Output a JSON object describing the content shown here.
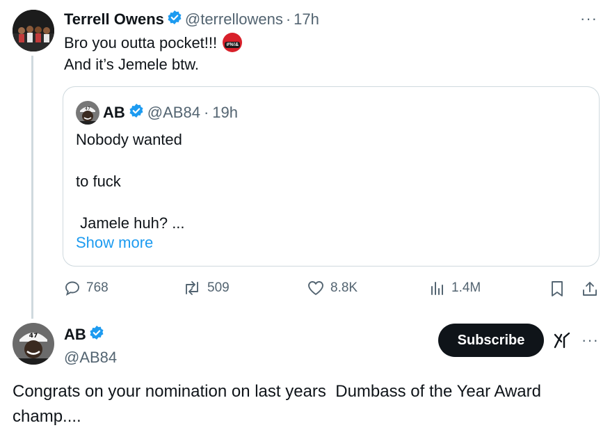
{
  "tweet": {
    "author_name": "Terrell Owens",
    "handle": "@terrellowens",
    "separator": "·",
    "time": "17h",
    "more": "···",
    "line1": "Bro you outta pocket!!!",
    "emoji_text": "#%!&",
    "line2": "And it’s Jemele btw."
  },
  "quote": {
    "author_name": "AB",
    "handle": "@AB84",
    "separator": "·",
    "time": "19h",
    "lines": [
      "Nobody wanted",
      "to fuck",
      " Jamele huh? ..."
    ],
    "show_more": "Show more"
  },
  "actions": {
    "replies": "768",
    "reposts": "509",
    "likes": "8.8K",
    "views": "1.4M"
  },
  "reply": {
    "author_name": "AB",
    "handle": "@AB84",
    "subscribe_label": "Subscribe",
    "more": "···",
    "body": "Congrats on your nomination on last years  Dumbass of the Year Award champ...."
  },
  "colors": {
    "accent": "#1d9bf0",
    "secondary_text": "#536471",
    "border": "#cfd9de",
    "subscribe_bg": "#0f1419"
  },
  "icons": [
    "verified-badge-icon",
    "angry-face-emoji-icon",
    "reply-icon",
    "repost-icon",
    "like-icon",
    "views-icon",
    "bookmark-icon",
    "share-icon",
    "grok-icon",
    "more-icon"
  ]
}
